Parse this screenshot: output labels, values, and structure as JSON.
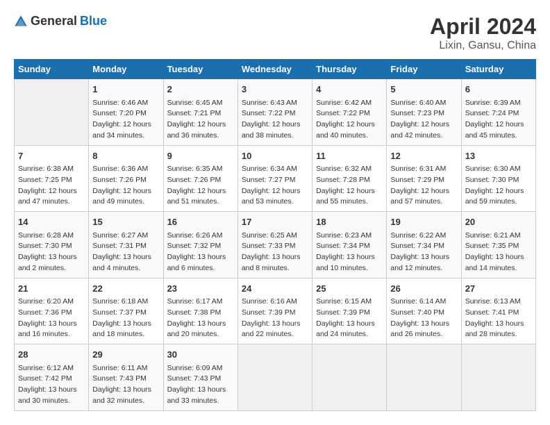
{
  "header": {
    "logo_general": "General",
    "logo_blue": "Blue",
    "month_year": "April 2024",
    "location": "Lixin, Gansu, China"
  },
  "days_of_week": [
    "Sunday",
    "Monday",
    "Tuesday",
    "Wednesday",
    "Thursday",
    "Friday",
    "Saturday"
  ],
  "weeks": [
    [
      {
        "day": "",
        "sunrise": "",
        "sunset": "",
        "daylight": "",
        "empty": true
      },
      {
        "day": "1",
        "sunrise": "Sunrise: 6:46 AM",
        "sunset": "Sunset: 7:20 PM",
        "daylight": "Daylight: 12 hours and 34 minutes."
      },
      {
        "day": "2",
        "sunrise": "Sunrise: 6:45 AM",
        "sunset": "Sunset: 7:21 PM",
        "daylight": "Daylight: 12 hours and 36 minutes."
      },
      {
        "day": "3",
        "sunrise": "Sunrise: 6:43 AM",
        "sunset": "Sunset: 7:22 PM",
        "daylight": "Daylight: 12 hours and 38 minutes."
      },
      {
        "day": "4",
        "sunrise": "Sunrise: 6:42 AM",
        "sunset": "Sunset: 7:22 PM",
        "daylight": "Daylight: 12 hours and 40 minutes."
      },
      {
        "day": "5",
        "sunrise": "Sunrise: 6:40 AM",
        "sunset": "Sunset: 7:23 PM",
        "daylight": "Daylight: 12 hours and 42 minutes."
      },
      {
        "day": "6",
        "sunrise": "Sunrise: 6:39 AM",
        "sunset": "Sunset: 7:24 PM",
        "daylight": "Daylight: 12 hours and 45 minutes."
      }
    ],
    [
      {
        "day": "7",
        "sunrise": "Sunrise: 6:38 AM",
        "sunset": "Sunset: 7:25 PM",
        "daylight": "Daylight: 12 hours and 47 minutes."
      },
      {
        "day": "8",
        "sunrise": "Sunrise: 6:36 AM",
        "sunset": "Sunset: 7:26 PM",
        "daylight": "Daylight: 12 hours and 49 minutes."
      },
      {
        "day": "9",
        "sunrise": "Sunrise: 6:35 AM",
        "sunset": "Sunset: 7:26 PM",
        "daylight": "Daylight: 12 hours and 51 minutes."
      },
      {
        "day": "10",
        "sunrise": "Sunrise: 6:34 AM",
        "sunset": "Sunset: 7:27 PM",
        "daylight": "Daylight: 12 hours and 53 minutes."
      },
      {
        "day": "11",
        "sunrise": "Sunrise: 6:32 AM",
        "sunset": "Sunset: 7:28 PM",
        "daylight": "Daylight: 12 hours and 55 minutes."
      },
      {
        "day": "12",
        "sunrise": "Sunrise: 6:31 AM",
        "sunset": "Sunset: 7:29 PM",
        "daylight": "Daylight: 12 hours and 57 minutes."
      },
      {
        "day": "13",
        "sunrise": "Sunrise: 6:30 AM",
        "sunset": "Sunset: 7:30 PM",
        "daylight": "Daylight: 12 hours and 59 minutes."
      }
    ],
    [
      {
        "day": "14",
        "sunrise": "Sunrise: 6:28 AM",
        "sunset": "Sunset: 7:30 PM",
        "daylight": "Daylight: 13 hours and 2 minutes."
      },
      {
        "day": "15",
        "sunrise": "Sunrise: 6:27 AM",
        "sunset": "Sunset: 7:31 PM",
        "daylight": "Daylight: 13 hours and 4 minutes."
      },
      {
        "day": "16",
        "sunrise": "Sunrise: 6:26 AM",
        "sunset": "Sunset: 7:32 PM",
        "daylight": "Daylight: 13 hours and 6 minutes."
      },
      {
        "day": "17",
        "sunrise": "Sunrise: 6:25 AM",
        "sunset": "Sunset: 7:33 PM",
        "daylight": "Daylight: 13 hours and 8 minutes."
      },
      {
        "day": "18",
        "sunrise": "Sunrise: 6:23 AM",
        "sunset": "Sunset: 7:34 PM",
        "daylight": "Daylight: 13 hours and 10 minutes."
      },
      {
        "day": "19",
        "sunrise": "Sunrise: 6:22 AM",
        "sunset": "Sunset: 7:34 PM",
        "daylight": "Daylight: 13 hours and 12 minutes."
      },
      {
        "day": "20",
        "sunrise": "Sunrise: 6:21 AM",
        "sunset": "Sunset: 7:35 PM",
        "daylight": "Daylight: 13 hours and 14 minutes."
      }
    ],
    [
      {
        "day": "21",
        "sunrise": "Sunrise: 6:20 AM",
        "sunset": "Sunset: 7:36 PM",
        "daylight": "Daylight: 13 hours and 16 minutes."
      },
      {
        "day": "22",
        "sunrise": "Sunrise: 6:18 AM",
        "sunset": "Sunset: 7:37 PM",
        "daylight": "Daylight: 13 hours and 18 minutes."
      },
      {
        "day": "23",
        "sunrise": "Sunrise: 6:17 AM",
        "sunset": "Sunset: 7:38 PM",
        "daylight": "Daylight: 13 hours and 20 minutes."
      },
      {
        "day": "24",
        "sunrise": "Sunrise: 6:16 AM",
        "sunset": "Sunset: 7:39 PM",
        "daylight": "Daylight: 13 hours and 22 minutes."
      },
      {
        "day": "25",
        "sunrise": "Sunrise: 6:15 AM",
        "sunset": "Sunset: 7:39 PM",
        "daylight": "Daylight: 13 hours and 24 minutes."
      },
      {
        "day": "26",
        "sunrise": "Sunrise: 6:14 AM",
        "sunset": "Sunset: 7:40 PM",
        "daylight": "Daylight: 13 hours and 26 minutes."
      },
      {
        "day": "27",
        "sunrise": "Sunrise: 6:13 AM",
        "sunset": "Sunset: 7:41 PM",
        "daylight": "Daylight: 13 hours and 28 minutes."
      }
    ],
    [
      {
        "day": "28",
        "sunrise": "Sunrise: 6:12 AM",
        "sunset": "Sunset: 7:42 PM",
        "daylight": "Daylight: 13 hours and 30 minutes."
      },
      {
        "day": "29",
        "sunrise": "Sunrise: 6:11 AM",
        "sunset": "Sunset: 7:43 PM",
        "daylight": "Daylight: 13 hours and 32 minutes."
      },
      {
        "day": "30",
        "sunrise": "Sunrise: 6:09 AM",
        "sunset": "Sunset: 7:43 PM",
        "daylight": "Daylight: 13 hours and 33 minutes."
      },
      {
        "day": "",
        "sunrise": "",
        "sunset": "",
        "daylight": "",
        "empty": true
      },
      {
        "day": "",
        "sunrise": "",
        "sunset": "",
        "daylight": "",
        "empty": true
      },
      {
        "day": "",
        "sunrise": "",
        "sunset": "",
        "daylight": "",
        "empty": true
      },
      {
        "day": "",
        "sunrise": "",
        "sunset": "",
        "daylight": "",
        "empty": true
      }
    ]
  ]
}
